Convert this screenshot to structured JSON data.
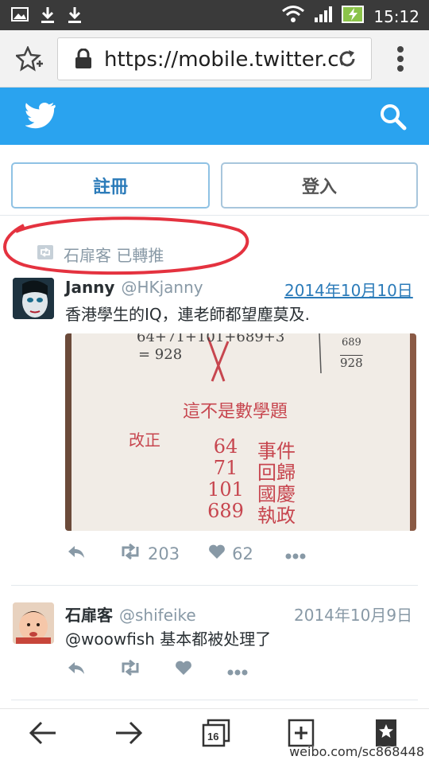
{
  "status_bar": {
    "time": "15:12",
    "icons": [
      "image-icon",
      "download-icon",
      "download-icon",
      "wifi-icon",
      "signal-icon",
      "battery-charging-icon"
    ]
  },
  "browser": {
    "url": "https://mobile.twitter.co",
    "icons": [
      "star-add-icon",
      "lock-icon",
      "reload-icon",
      "overflow-menu-icon"
    ]
  },
  "twitter": {
    "brand_color": "#2aa3ef",
    "icons": [
      "twitter-bird-icon",
      "search-icon"
    ],
    "register_label": "註冊",
    "login_label": "登入"
  },
  "retweet_context": {
    "text": "石扉客 已轉推"
  },
  "tweets": [
    {
      "name": "Janny",
      "handle": "@HKjanny",
      "date": "2014年10月10日",
      "text": "香港學生的IQ，連老師都望塵莫及.",
      "image": {
        "top_left": "64+71+101+689+3",
        "top_left_result": "= 928",
        "top_right_calc": "689",
        "top_right_result": "928",
        "note": "這不是數學題",
        "correction_label": "改正",
        "lines": [
          {
            "num": "64",
            "word": "事件"
          },
          {
            "num": "71",
            "word": "回歸"
          },
          {
            "num": "101",
            "word": "國慶"
          },
          {
            "num": "689",
            "word": "執政"
          }
        ]
      },
      "retweets": "203",
      "likes": "62"
    },
    {
      "name": "石扉客",
      "handle": "@shifeike",
      "date": "2014年10月9日",
      "text": "@woowfish 基本都被处理了",
      "retweets": "",
      "likes": ""
    }
  ],
  "bottom_nav": {
    "tabs_count": "16",
    "icons": [
      "back-arrow-icon",
      "forward-arrow-icon",
      "tabs-icon",
      "new-tab-icon",
      "bookmark-star-icon"
    ],
    "watermark": "weibo.com/sc868448"
  }
}
